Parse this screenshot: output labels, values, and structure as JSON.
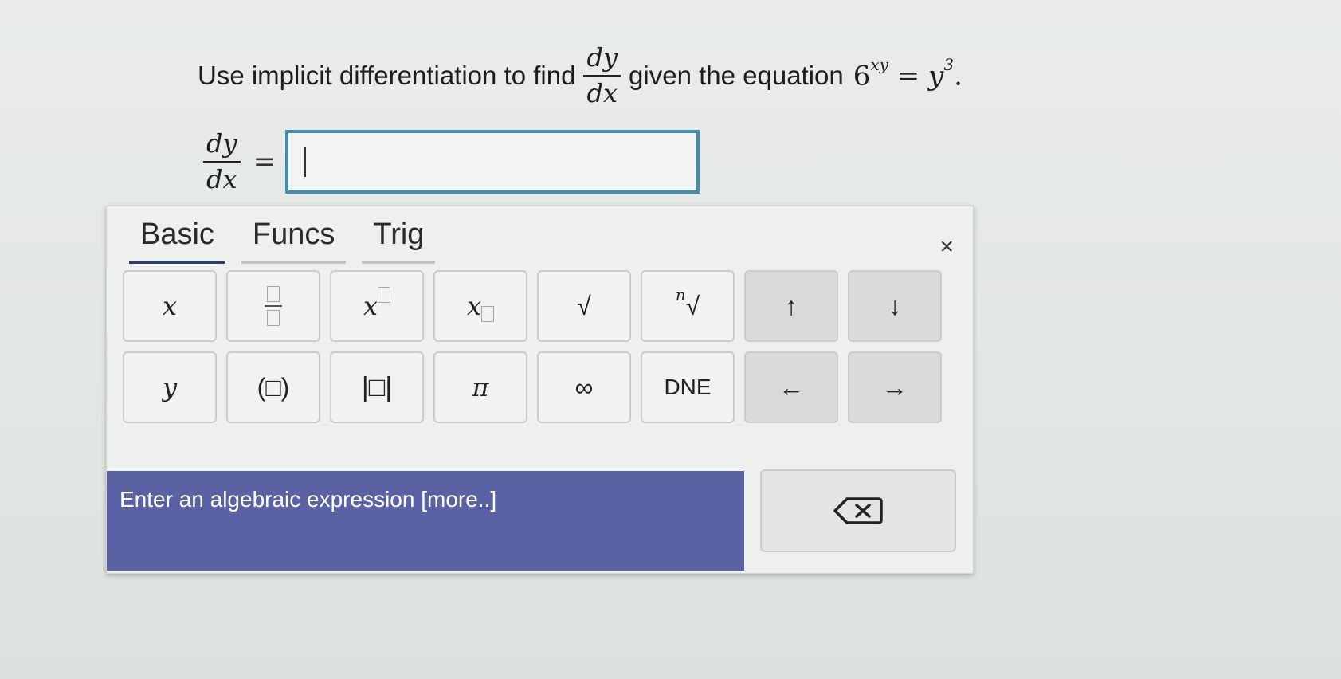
{
  "question": {
    "prefix": "Use implicit differentiation to find",
    "frac_num": "dy",
    "frac_den": "dx",
    "middle": "given the equation",
    "eq_base": "6",
    "eq_exp": "xy",
    "eq_equals": "=",
    "eq_rhs": "y",
    "eq_rhs_exp": "3",
    "eq_end": "."
  },
  "answer": {
    "lhs_num": "dy",
    "lhs_den": "dx",
    "equals": "=",
    "value": ""
  },
  "palette": {
    "tabs": [
      {
        "label": "Basic",
        "active": true
      },
      {
        "label": "Funcs",
        "active": false
      },
      {
        "label": "Trig",
        "active": false
      }
    ],
    "close": "×",
    "keys_row1": [
      "x",
      "fraction",
      "x",
      "x",
      "√",
      "n",
      "↑",
      "↓"
    ],
    "keys_row2": [
      "y",
      "(□)",
      "|□|",
      "π",
      "∞",
      "DNE",
      "←",
      "→"
    ],
    "nthroot_index": "n",
    "hint": "Enter an algebraic expression [more..]",
    "icons": [
      "backspace-icon"
    ]
  }
}
